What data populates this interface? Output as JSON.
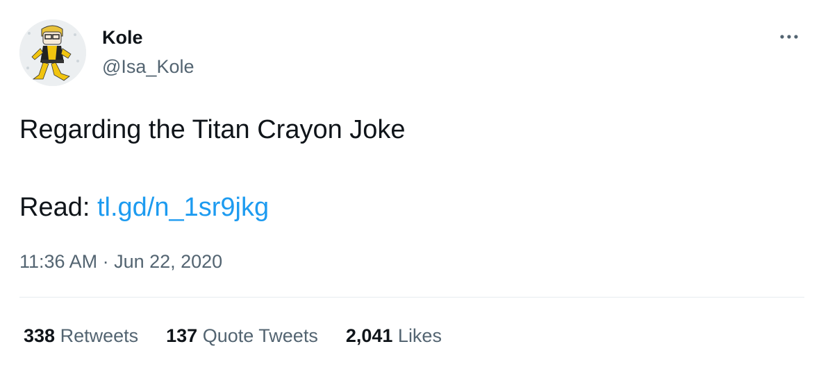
{
  "author": {
    "display_name": "Kole",
    "handle": "@Isa_Kole",
    "avatar_icon": "cartoon-character-avatar"
  },
  "tweet": {
    "text": "Regarding the Titan Crayon Joke",
    "read_prefix": "Read:",
    "link_text": "tl.gd/n_1sr9jkg",
    "timestamp": "11:36 AM · Jun 22, 2020"
  },
  "stats": [
    {
      "count": "338",
      "label": "Retweets"
    },
    {
      "count": "137",
      "label": "Quote Tweets"
    },
    {
      "count": "2,041",
      "label": "Likes"
    }
  ],
  "colors": {
    "text": "#0f1419",
    "secondary": "#536471",
    "link": "#1d9bf0",
    "divider": "#e6ecf0"
  },
  "icons": {
    "more": "more-horizontal-icon"
  }
}
